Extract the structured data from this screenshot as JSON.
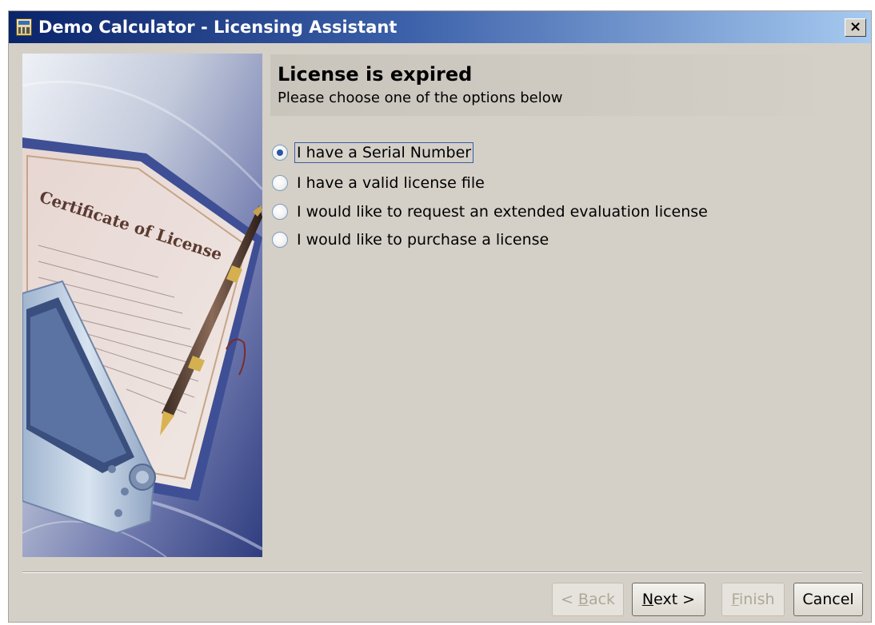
{
  "window": {
    "title": "Demo Calculator - Licensing Assistant",
    "close_label": "×"
  },
  "header": {
    "title": "License is expired",
    "subtitle": "Please choose one of the options below"
  },
  "options": [
    {
      "label": "I have a Serial Number",
      "selected": true
    },
    {
      "label": "I have a valid license file",
      "selected": false
    },
    {
      "label": "I would like to request an extended evaluation license",
      "selected": false
    },
    {
      "label": "I would like to purchase a license",
      "selected": false
    }
  ],
  "buttons": {
    "back": {
      "pre": "< ",
      "mnemonic": "B",
      "post": "ack",
      "enabled": false
    },
    "next": {
      "pre": "",
      "mnemonic": "N",
      "post": "ext >",
      "enabled": true
    },
    "finish": {
      "pre": "",
      "mnemonic": "F",
      "post": "inish",
      "enabled": false
    },
    "cancel": {
      "label": "Cancel",
      "enabled": true
    }
  },
  "colors": {
    "titlebar_start": "#0a246a",
    "titlebar_end": "#a6caf0",
    "dialog_bg": "#d4d0c8",
    "radio_dot": "#2b56a6"
  },
  "icons": [
    "app-calculator-icon",
    "close-icon",
    "radio-selected-icon",
    "radio-unselected-icon"
  ]
}
